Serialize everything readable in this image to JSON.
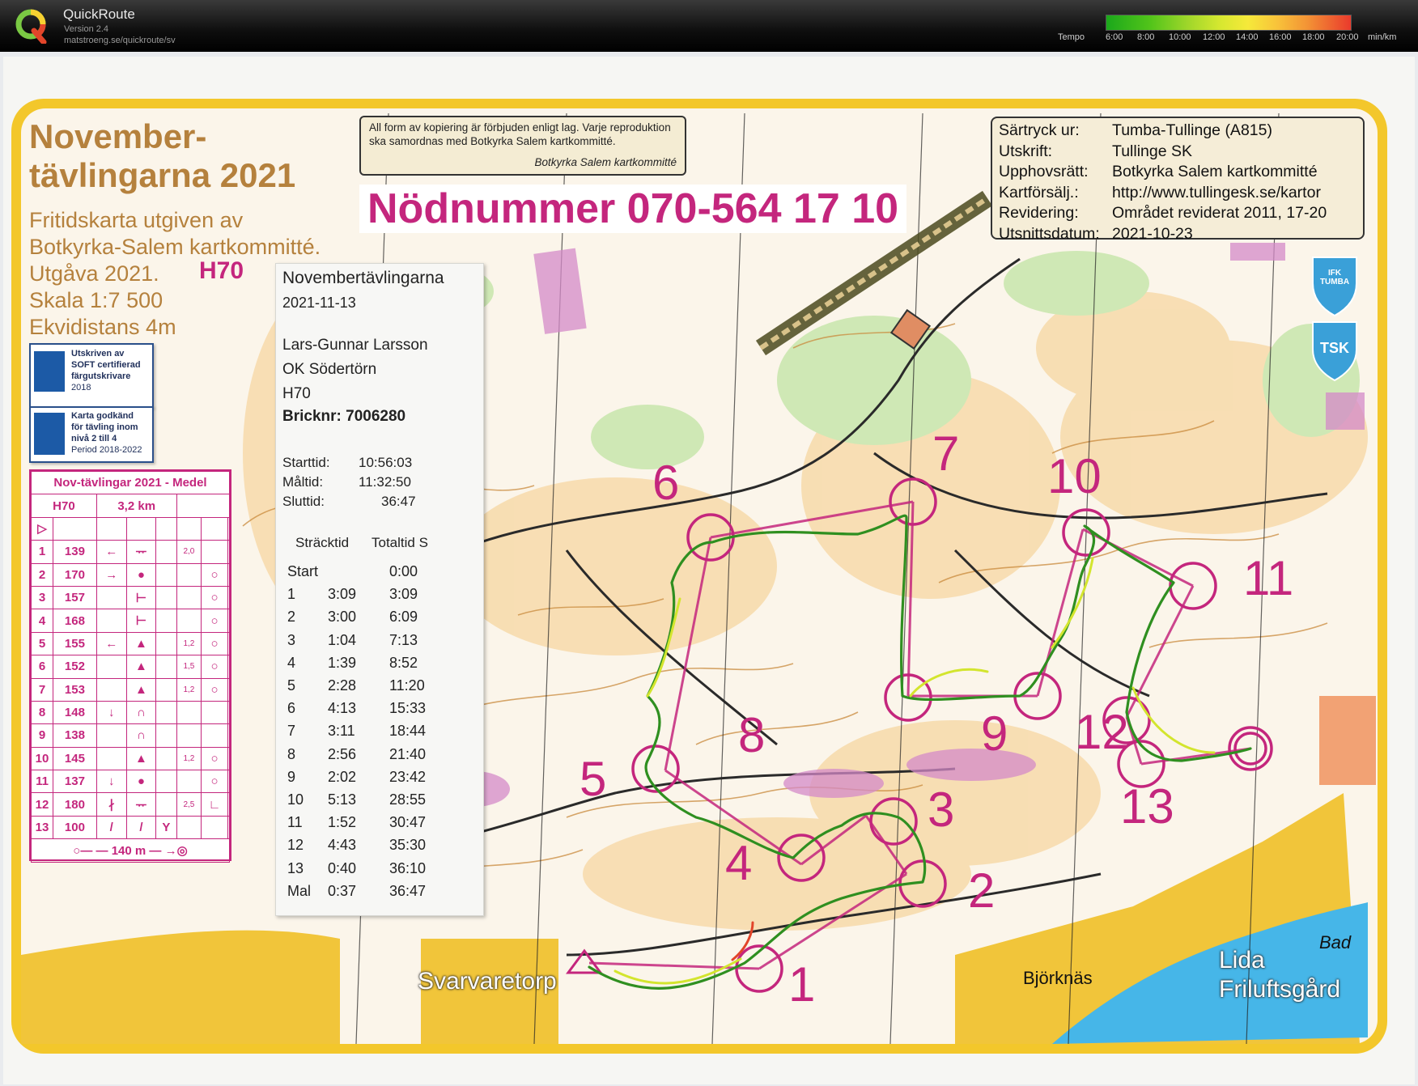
{
  "app": {
    "name": "QuickRoute",
    "version": "Version 2.4",
    "url": "matstroeng.se/quickroute/sv"
  },
  "tempo": {
    "label": "Tempo",
    "ticks": [
      "6:00",
      "8:00",
      "10:00",
      "12:00",
      "14:00",
      "16:00",
      "18:00",
      "20:00"
    ],
    "unit": "min/km",
    "colors": [
      "#1ba81b",
      "#9ed62a",
      "#f6e93a",
      "#f39435",
      "#ea3a2c"
    ]
  },
  "map": {
    "header_title": [
      "November-",
      "tävlingarna 2021"
    ],
    "header_sub": [
      "Fritidskarta utgiven av",
      "Botkyrka-Salem kartkommitté.",
      "Utgåva 2021.",
      "Skala 1:7 500",
      "Ekvidistans 4m"
    ],
    "class": "H70",
    "badge1": [
      "Utskriven av",
      "SOFT certifierad",
      "färgutskrivare",
      "2018"
    ],
    "badge2": [
      "Karta godkänd",
      "för tävling inom",
      "nivå 2 till 4",
      "Period 2018-2022"
    ],
    "notice": "All form av kopiering är förbjuden enligt lag. Varje reproduktion ska samordnas med Botkyrka Salem kartkommitté.",
    "notice_sig": "Botkyrka Salem kartkommitté",
    "emergency": "Nödnummer 070-564 17 10",
    "info_rows": [
      {
        "key": "Särtryck ur:",
        "val": "Tumba-Tullinge (A815)"
      },
      {
        "key": "Utskrift:",
        "val": "Tullinge SK"
      },
      {
        "key": "Upphovsrätt:",
        "val": "Botkyrka Salem kartkommitté"
      },
      {
        "key": "Kartförsälj.:",
        "val": "http://www.tullingesk.se/kartor"
      },
      {
        "key": "Revidering:",
        "val": "Området reviderat 2011, 17-20"
      },
      {
        "key": "Utsnittsdatum:",
        "val": "2021-10-23"
      }
    ],
    "club1": "IFK TUMBA",
    "club2": "TSK",
    "places": [
      "Svarvaretorp",
      "Björknäs",
      "Lida",
      "Friluftsgård",
      "Bad"
    ]
  },
  "control_card": {
    "title": "Nov-tävlingar 2021 - Medel",
    "class": "H70",
    "length": "3,2 km",
    "rows": [
      {
        "n": "1",
        "code": "139",
        "dist": "2,0"
      },
      {
        "n": "2",
        "code": "170",
        "dist": ""
      },
      {
        "n": "3",
        "code": "157",
        "dist": ""
      },
      {
        "n": "4",
        "code": "168",
        "dist": ""
      },
      {
        "n": "5",
        "code": "155",
        "dist": "1,2"
      },
      {
        "n": "6",
        "code": "152",
        "dist": "1,5"
      },
      {
        "n": "7",
        "code": "153",
        "dist": "1,2"
      },
      {
        "n": "8",
        "code": "148",
        "dist": ""
      },
      {
        "n": "9",
        "code": "138",
        "dist": ""
      },
      {
        "n": "10",
        "code": "145",
        "dist": "1,2"
      },
      {
        "n": "11",
        "code": "137",
        "dist": ""
      },
      {
        "n": "12",
        "code": "180",
        "dist": "2,5"
      },
      {
        "n": "13",
        "code": "100",
        "dist": ""
      }
    ],
    "finish": "140 m"
  },
  "receipt": {
    "event": "Novembertävlingarna",
    "date": "2021-11-13",
    "name": "Lars-Gunnar Larsson",
    "club": "OK Södertörn",
    "class": "H70",
    "card": "Bricknr: 7006280",
    "start_label": "Starttid:",
    "start": "10:56:03",
    "finish_label": "Måltid:",
    "finish": "11:32:50",
    "result_label": "Sluttid:",
    "result": "36:47",
    "col1": "Sträcktid",
    "col2": "Totaltid S",
    "splits": [
      {
        "n": "Start",
        "leg": "",
        "total": "0:00"
      },
      {
        "n": "1",
        "leg": "3:09",
        "total": "3:09"
      },
      {
        "n": "2",
        "leg": "3:00",
        "total": "6:09"
      },
      {
        "n": "3",
        "leg": "1:04",
        "total": "7:13"
      },
      {
        "n": "4",
        "leg": "1:39",
        "total": "8:52"
      },
      {
        "n": "5",
        "leg": "2:28",
        "total": "11:20"
      },
      {
        "n": "6",
        "leg": "4:13",
        "total": "15:33"
      },
      {
        "n": "7",
        "leg": "3:11",
        "total": "18:44"
      },
      {
        "n": "8",
        "leg": "2:56",
        "total": "21:40"
      },
      {
        "n": "9",
        "leg": "2:02",
        "total": "23:42"
      },
      {
        "n": "10",
        "leg": "5:13",
        "total": "28:55"
      },
      {
        "n": "11",
        "leg": "1:52",
        "total": "30:47"
      },
      {
        "n": "12",
        "leg": "4:43",
        "total": "35:30"
      },
      {
        "n": "13",
        "leg": "0:40",
        "total": "36:10"
      },
      {
        "n": "Mal",
        "leg": "0:37",
        "total": "36:47"
      }
    ]
  },
  "controls_on_map": [
    "1",
    "2",
    "3",
    "4",
    "5",
    "6",
    "7",
    "8",
    "9",
    "10",
    "11",
    "12",
    "13"
  ]
}
